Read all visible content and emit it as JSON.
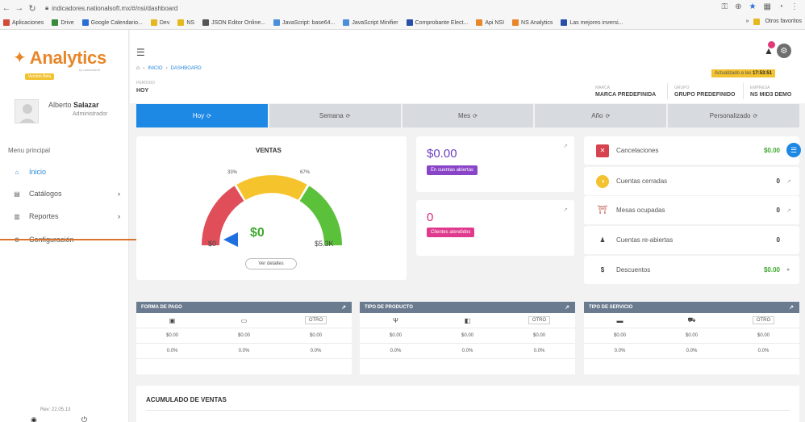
{
  "browser": {
    "url": "indicadores.nationalsoft.mx/#/nsi/dashboard",
    "bookmarks": [
      {
        "label": "Aplicaciones",
        "color": "#d04a3a"
      },
      {
        "label": "Drive",
        "color": "#3a8b3a"
      },
      {
        "label": "Google Calendario...",
        "color": "#2a6fd8"
      },
      {
        "label": "Dev",
        "color": "#e6b81f"
      },
      {
        "label": "NS",
        "color": "#e6b81f"
      },
      {
        "label": "JSON Editor Online...",
        "color": "#555555"
      },
      {
        "label": "JavaScript: base64...",
        "color": "#4a90d9"
      },
      {
        "label": "JavaScript Minifier",
        "color": "#4a90d9"
      },
      {
        "label": "Comprobante Elect...",
        "color": "#2a4fa8"
      },
      {
        "label": "Api NSI",
        "color": "#e8862a"
      },
      {
        "label": "NS Analytics",
        "color": "#e8862a"
      },
      {
        "label": "Las mejores inversi...",
        "color": "#2a4fa8"
      }
    ],
    "other_bookmarks": "Otros favoritos"
  },
  "sidebar": {
    "logo": "Analytics",
    "logo_sub": "by nationalsoft",
    "version_badge": "Versión Beta",
    "user_first": "Alberto",
    "user_last": "Salazar",
    "user_role": "Administrador",
    "menu_title": "Menu principal",
    "items": [
      {
        "label": "Inicio",
        "icon": "home-icon"
      },
      {
        "label": "Catálogos",
        "icon": "grid-icon"
      },
      {
        "label": "Reportes",
        "icon": "report-icon"
      },
      {
        "label": "Configuración",
        "icon": "gear-icon"
      }
    ],
    "revision": "Rev: 22.05.13"
  },
  "header": {
    "breadcrumb_home": "INICIO",
    "breadcrumb_current": "DASHBOARD",
    "period_label": "PERÍODO",
    "period_value": "HOY",
    "updated_prefix": "Actualizado a las",
    "updated_time": "17:53:51",
    "marca_label": "MARCA",
    "marca_value": "MARCA PREDEFINIDA",
    "grupo_label": "GRUPO",
    "grupo_value": "GRUPO PREDEFINIDO",
    "empresa_label": "EMPRESA",
    "empresa_value": "NS MID3 DEMO"
  },
  "tabs": [
    {
      "label": "Hoy",
      "active": true
    },
    {
      "label": "Semana",
      "active": false
    },
    {
      "label": "Mes",
      "active": false
    },
    {
      "label": "Año",
      "active": false
    },
    {
      "label": "Personalizado",
      "active": false
    }
  ],
  "ventas": {
    "title": "VENTAS",
    "pct_left": "33%",
    "pct_right": "67%",
    "min": "$0",
    "max": "$5.3K",
    "value": "$0",
    "details_button": "Ver detalles"
  },
  "open_accounts": {
    "value": "$0.00",
    "badge": "En cuentas abiertas"
  },
  "customers": {
    "value": "0",
    "badge": "Clientes atendidos"
  },
  "summary": [
    {
      "label": "Cancelaciones",
      "value": "$0.00",
      "green": true,
      "icon": "cancel-icon"
    },
    {
      "label": "Cuentas cerradas",
      "value": "0",
      "green": false,
      "icon": "closed-accounts-icon"
    },
    {
      "label": "Mesas ocupadas",
      "value": "0",
      "green": false,
      "icon": "tables-icon"
    },
    {
      "label": "Cuentas re-abiertas",
      "value": "0",
      "green": false,
      "icon": "user-icon"
    },
    {
      "label": "Descuentos",
      "value": "$0.00",
      "green": true,
      "icon": "dollar-icon"
    }
  ],
  "tables": [
    {
      "title": "FORMA DE PAGO",
      "otro": "OTRO",
      "values": [
        "$0.00",
        "$0.00",
        "$0.00"
      ],
      "pcts": [
        "0.0%",
        "0.0%",
        "0.0%"
      ]
    },
    {
      "title": "TIPO DE PRODUCTO",
      "otro": "OTRO",
      "values": [
        "$0.00",
        "$0.00",
        "$0.00"
      ],
      "pcts": [
        "0.0%",
        "0.0%",
        "0.0%"
      ]
    },
    {
      "title": "TIPO DE SERVICIO",
      "otro": "OTRO",
      "values": [
        "$0.00",
        "$0.00",
        "$0.00"
      ],
      "pcts": [
        "0.0%",
        "0.0%",
        "0.0%"
      ]
    }
  ],
  "acumulado_title": "ACUMULADO DE VENTAS",
  "colors": {
    "accent": "#1e88e5",
    "brand": "#e8862a",
    "green": "#3fa82f",
    "purple": "#8a44c8",
    "pink": "#e03a8f"
  }
}
